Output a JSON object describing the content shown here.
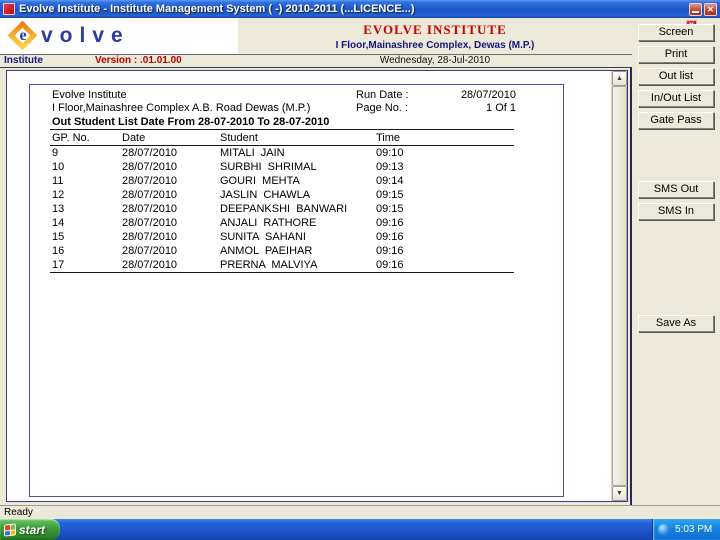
{
  "window": {
    "title": "Evolve Institute - Institute Management System ( -) 2010-2011 (...LICENCE...)",
    "status": "Ready"
  },
  "icons": {
    "close_glyph": "✕",
    "scroll_up_glyph": "▲",
    "scroll_down_glyph": "▼"
  },
  "header": {
    "logo_e": "e",
    "logo_text": "volve",
    "institute_name": "EVOLVE INSTITUTE",
    "institute_address": "I Floor,Mainashree Complex, Dewas (M.P.)",
    "module": "Institute",
    "version": "Version : .01.01.00",
    "date": "Wednesday, 28-Jul-2010"
  },
  "report": {
    "institute": "Evolve Institute",
    "address": "I Floor,Mainashree Complex A.B. Road Dewas (M.P.)",
    "run_date_label": "Run Date :",
    "run_date": "28/07/2010",
    "page_label": "Page No. :",
    "page": "1 Of 1",
    "title": "Out Student List Date From 28-07-2010 To 28-07-2010",
    "columns": [
      "GP. No.",
      "Date",
      "Student",
      "Time"
    ],
    "rows": [
      [
        "9",
        "28/07/2010",
        "MITALI  JAIN",
        "09:10"
      ],
      [
        "10",
        "28/07/2010",
        "SURBHI  SHRIMAL",
        "09:13"
      ],
      [
        "11",
        "28/07/2010",
        "GOURI  MEHTA",
        "09:14"
      ],
      [
        "12",
        "28/07/2010",
        "JASLIN  CHAWLA",
        "09:15"
      ],
      [
        "13",
        "28/07/2010",
        "DEEPANKSHI  BANWARI",
        "09:15"
      ],
      [
        "14",
        "28/07/2010",
        "ANJALI  RATHORE",
        "09:16"
      ],
      [
        "15",
        "28/07/2010",
        "SUNITA  SAHANI",
        "09:16"
      ],
      [
        "16",
        "28/07/2010",
        "ANMOL  PAEIHAR",
        "09:16"
      ],
      [
        "17",
        "28/07/2010",
        "PRERNA  MALVIYA",
        "09:16"
      ]
    ]
  },
  "sidebar": {
    "buttons": [
      "Screen",
      "Print",
      "Out list",
      "In/Out List",
      "Gate Pass",
      "SMS Out",
      "SMS In",
      "Save As"
    ]
  },
  "taskbar": {
    "start_label": "start",
    "time": "5:03 PM"
  },
  "colors": {
    "accent_red": "#CC0000",
    "navy": "#16167E",
    "tan": "#ECE9D8"
  }
}
